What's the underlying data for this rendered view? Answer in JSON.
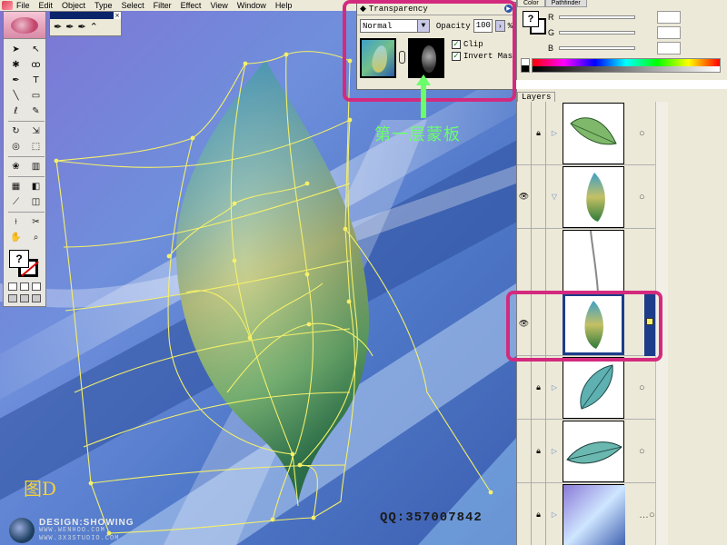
{
  "menubar": {
    "items": [
      "File",
      "Edit",
      "Object",
      "Type",
      "Select",
      "Filter",
      "Effect",
      "View",
      "Window",
      "Help"
    ]
  },
  "toolbox": {
    "fill_label": "?"
  },
  "pen_popup": {
    "close_label": "×"
  },
  "transparency": {
    "title": "Transparency",
    "blend_mode": "Normal",
    "opacity_label": "Opacity",
    "opacity_value": "100",
    "opacity_unit": "%",
    "clip_label": "Clip",
    "invert_label": "Invert Mas"
  },
  "color_panel": {
    "tabs": [
      "Color",
      "Pathfinder"
    ],
    "fill_label": "?",
    "channels": [
      "R",
      "G",
      "B"
    ]
  },
  "layers_panel": {
    "tab_label": "Layers"
  },
  "annotations": {
    "mask_label": "第一层蒙板",
    "figure_label": "图D",
    "qq_label": "QQ:357007842",
    "watermark_line1": "DESIGN:SHOWING",
    "watermark_line2a": "WWW.WENHOO.COM",
    "watermark_line2b": "WWW.3X3STUDIO.COM"
  },
  "colors": {
    "highlight": "#d42a7e",
    "mesh_line": "#f4f06a",
    "annot_green": "#6aff6a",
    "figure_label": "#f2d03a"
  }
}
